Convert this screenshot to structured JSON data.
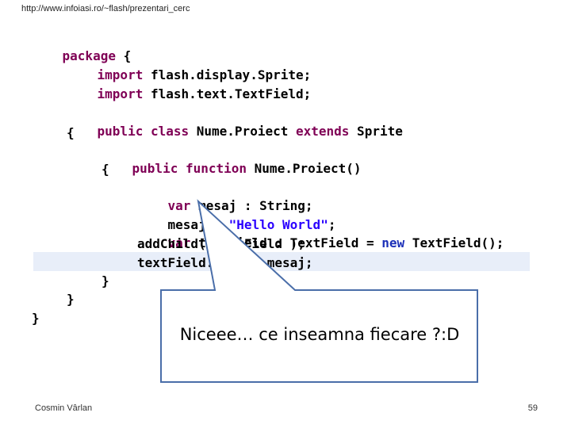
{
  "header": {
    "url": "http://www.infoiasi.ro/~flash/prezentari_cerc"
  },
  "code": {
    "l1": {
      "kw": "package",
      "rest": " {"
    },
    "l2": {
      "kw": "import",
      "rest": " flash.display.Sprite;"
    },
    "l3": {
      "kw": "import",
      "rest": " flash.text.TextField;"
    },
    "l4": {
      "kw1": "public",
      "kw2": " class",
      "name": " Nume.Proiect",
      "kw3": " extends",
      "rest": " Sprite"
    },
    "l5": {
      "text": "{"
    },
    "l6": {
      "kw1": "public",
      "kw2": " function",
      "name": " Nume.Proiect()"
    },
    "l7": {
      "text": "{"
    },
    "l8": {
      "kw": "var",
      "rest": " mesaj : String;"
    },
    "l9": {
      "pre": "mesaj = ",
      "str": "\"Hello World\"",
      "post": ";"
    },
    "l10": {
      "kw": "var",
      "pre": " textField : TextField = ",
      "kw2": "new",
      "post": " TextField();"
    },
    "l11": {
      "text": "addChild( textField );"
    },
    "l12": {
      "text": "textField.text = mesaj;"
    },
    "l13": {
      "text": "}"
    },
    "l14": {
      "text": "}"
    },
    "l15": {
      "text": "}"
    }
  },
  "callout": {
    "text": "Niceee… ce inseamna fiecare ?:D"
  },
  "footer": {
    "author": "Cosmin Vârlan",
    "page": "59"
  },
  "colors": {
    "keyword": "#7f0055",
    "string": "#2a00ff",
    "highlight": "#e8eef9",
    "callout_border": "#4a6ea9"
  }
}
